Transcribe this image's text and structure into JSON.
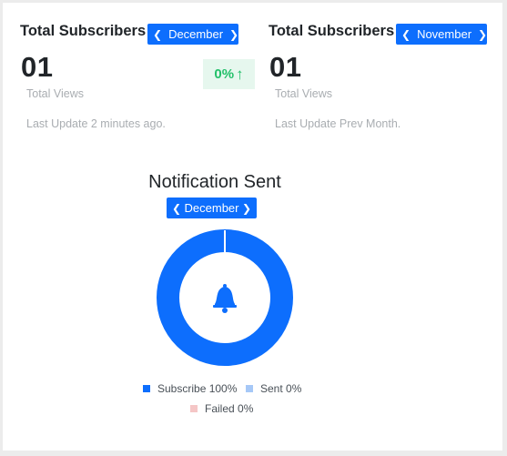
{
  "stats": [
    {
      "title": "Total Subscribers",
      "month": "December",
      "value": "01",
      "subtitle": "Total Views",
      "update": "Last Update 2 minutes ago.",
      "change": "0%"
    },
    {
      "title": "Total Subscribers",
      "month": "November",
      "value": "01",
      "subtitle": "Total Views",
      "update": "Last Update Prev Month."
    }
  ],
  "notification": {
    "title": "Notification Sent",
    "month": "December",
    "center_icon": "bell-icon"
  },
  "chart_data": {
    "type": "pie",
    "style": "donut",
    "categories": [
      "Subscribe",
      "Sent",
      "Failed"
    ],
    "values": [
      100,
      0,
      0
    ],
    "legend": [
      "Subscribe 100%",
      "Sent 0%",
      "Failed 0%"
    ],
    "colors": [
      "#0d6efd",
      "#a6c8f7",
      "#f5c6c6"
    ],
    "legend_position": "bottom"
  },
  "colors": {
    "accent": "#0d6efd",
    "positive": "#23c06a",
    "positive_bg": "#e6f7ee",
    "muted_text": "#a9adb1"
  }
}
